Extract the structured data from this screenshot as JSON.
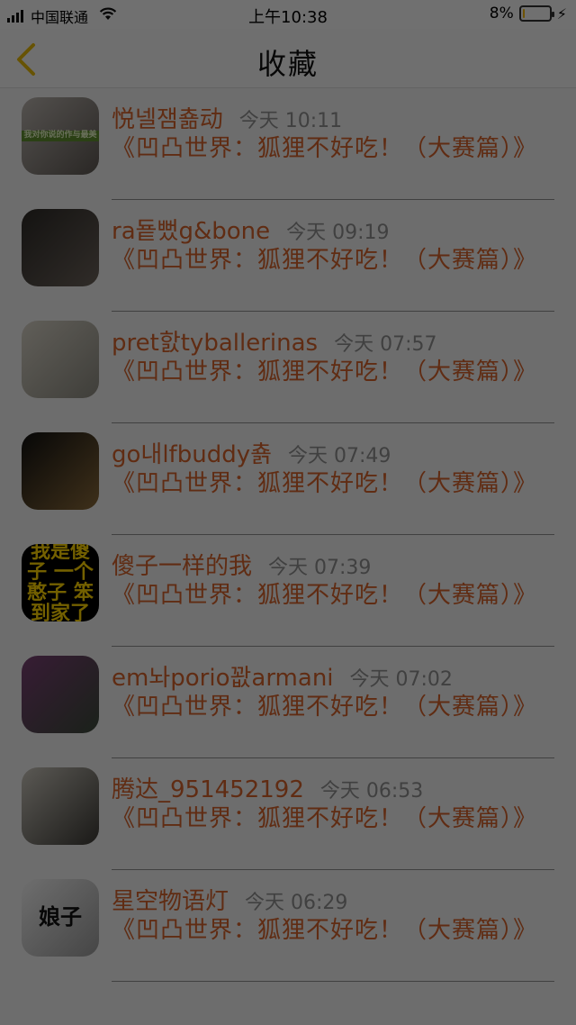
{
  "status_bar": {
    "carrier": "中国联通",
    "time": "上午10:38",
    "battery": "8%",
    "battery_level": 0.08
  },
  "nav": {
    "title": "收藏",
    "back_icon": "chevron-left-icon"
  },
  "items": [
    {
      "name": "悦넬잼춂动",
      "time": "今天 10:11",
      "title": "《凹凸世界：狐狸不好吃！（大赛篇）》",
      "avatar": {
        "caption": "我对你说的作与最美",
        "colors": [
          "#b9b3ad",
          "#5d5752"
        ]
      }
    },
    {
      "name": "ra둍뻤g&bone",
      "time": "今天 09:19",
      "title": "《凹凸世界：狐狸不好吃！（大赛篇）》",
      "avatar": {
        "caption": "",
        "colors": [
          "#2d2a27",
          "#6b625a"
        ]
      }
    },
    {
      "name": "pret핤tyballerinas",
      "time": "今天 07:57",
      "title": "《凹凸世界：狐狸不好吃！（大赛篇）》",
      "avatar": {
        "caption": "",
        "colors": [
          "#d6d1c5",
          "#8c8a80"
        ]
      }
    },
    {
      "name": "go내lfbuddy춁",
      "time": "今天 07:49",
      "title": "《凹凸世界：狐狸不好吃！（大赛篇）》",
      "avatar": {
        "caption": "",
        "colors": [
          "#101010",
          "#8a6a3a"
        ]
      }
    },
    {
      "name": "傻子一样的我",
      "time": "今天 07:39",
      "title": "《凹凸世界：狐狸不好吃！（大赛篇）》",
      "avatar": {
        "caption": "我是傻子 一个憨子 笨到家了",
        "colors": [
          "#000000",
          "#000000"
        ]
      }
    },
    {
      "name": "em놔porio꽚armani",
      "time": "今天 07:02",
      "title": "《凹凸世界：狐狸不好吃！（大赛篇）》",
      "avatar": {
        "caption": "",
        "colors": [
          "#7a3f74",
          "#3b4a3a"
        ]
      }
    },
    {
      "name": "腾达_951452192",
      "time": "今天 06:53",
      "title": "《凹凸世界：狐狸不好吃！（大赛篇）》",
      "avatar": {
        "caption": "",
        "colors": [
          "#c9c5bb",
          "#3c3a35"
        ]
      }
    },
    {
      "name": "星空物语灯",
      "time": "今天 06:29",
      "title": "《凹凸世界：狐狸不好吃！（大赛篇）》",
      "avatar": {
        "caption": "娘子",
        "colors": [
          "#f4f4f4",
          "#9a9a9a"
        ]
      }
    }
  ]
}
